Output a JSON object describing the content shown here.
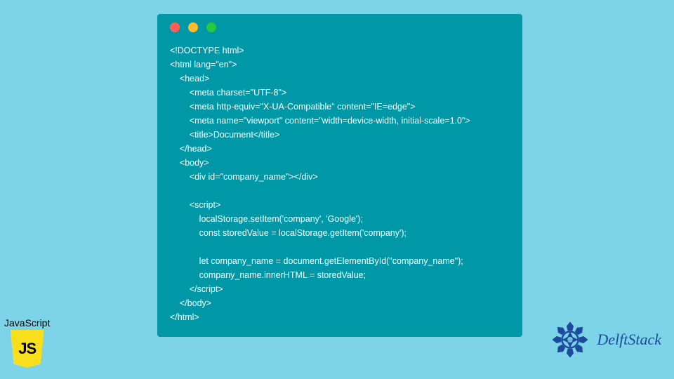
{
  "code": {
    "lines": [
      "<!DOCTYPE html>",
      "<html lang=\"en\">",
      "    <head>",
      "        <meta charset=\"UTF-8\">",
      "        <meta http-equiv=\"X-UA-Compatible\" content=\"IE=edge\">",
      "        <meta name=\"viewport\" content=\"width=device-width, initial-scale=1.0\">",
      "        <title>Document</title>",
      "    </head>",
      "    <body>",
      "        <div id=\"company_name\"></div>",
      "",
      "        <script>",
      "            localStorage.setItem('company', 'Google');",
      "            const storedValue = localStorage.getItem('company');",
      "",
      "            let company_name = document.getElementById(\"company_name\");",
      "            company_name.innerHTML = storedValue;",
      "        </script>",
      "    </body>",
      "</html>"
    ]
  },
  "js_badge": {
    "label": "JavaScript",
    "shield_text": "JS"
  },
  "delft": {
    "text": "DelftStack"
  }
}
